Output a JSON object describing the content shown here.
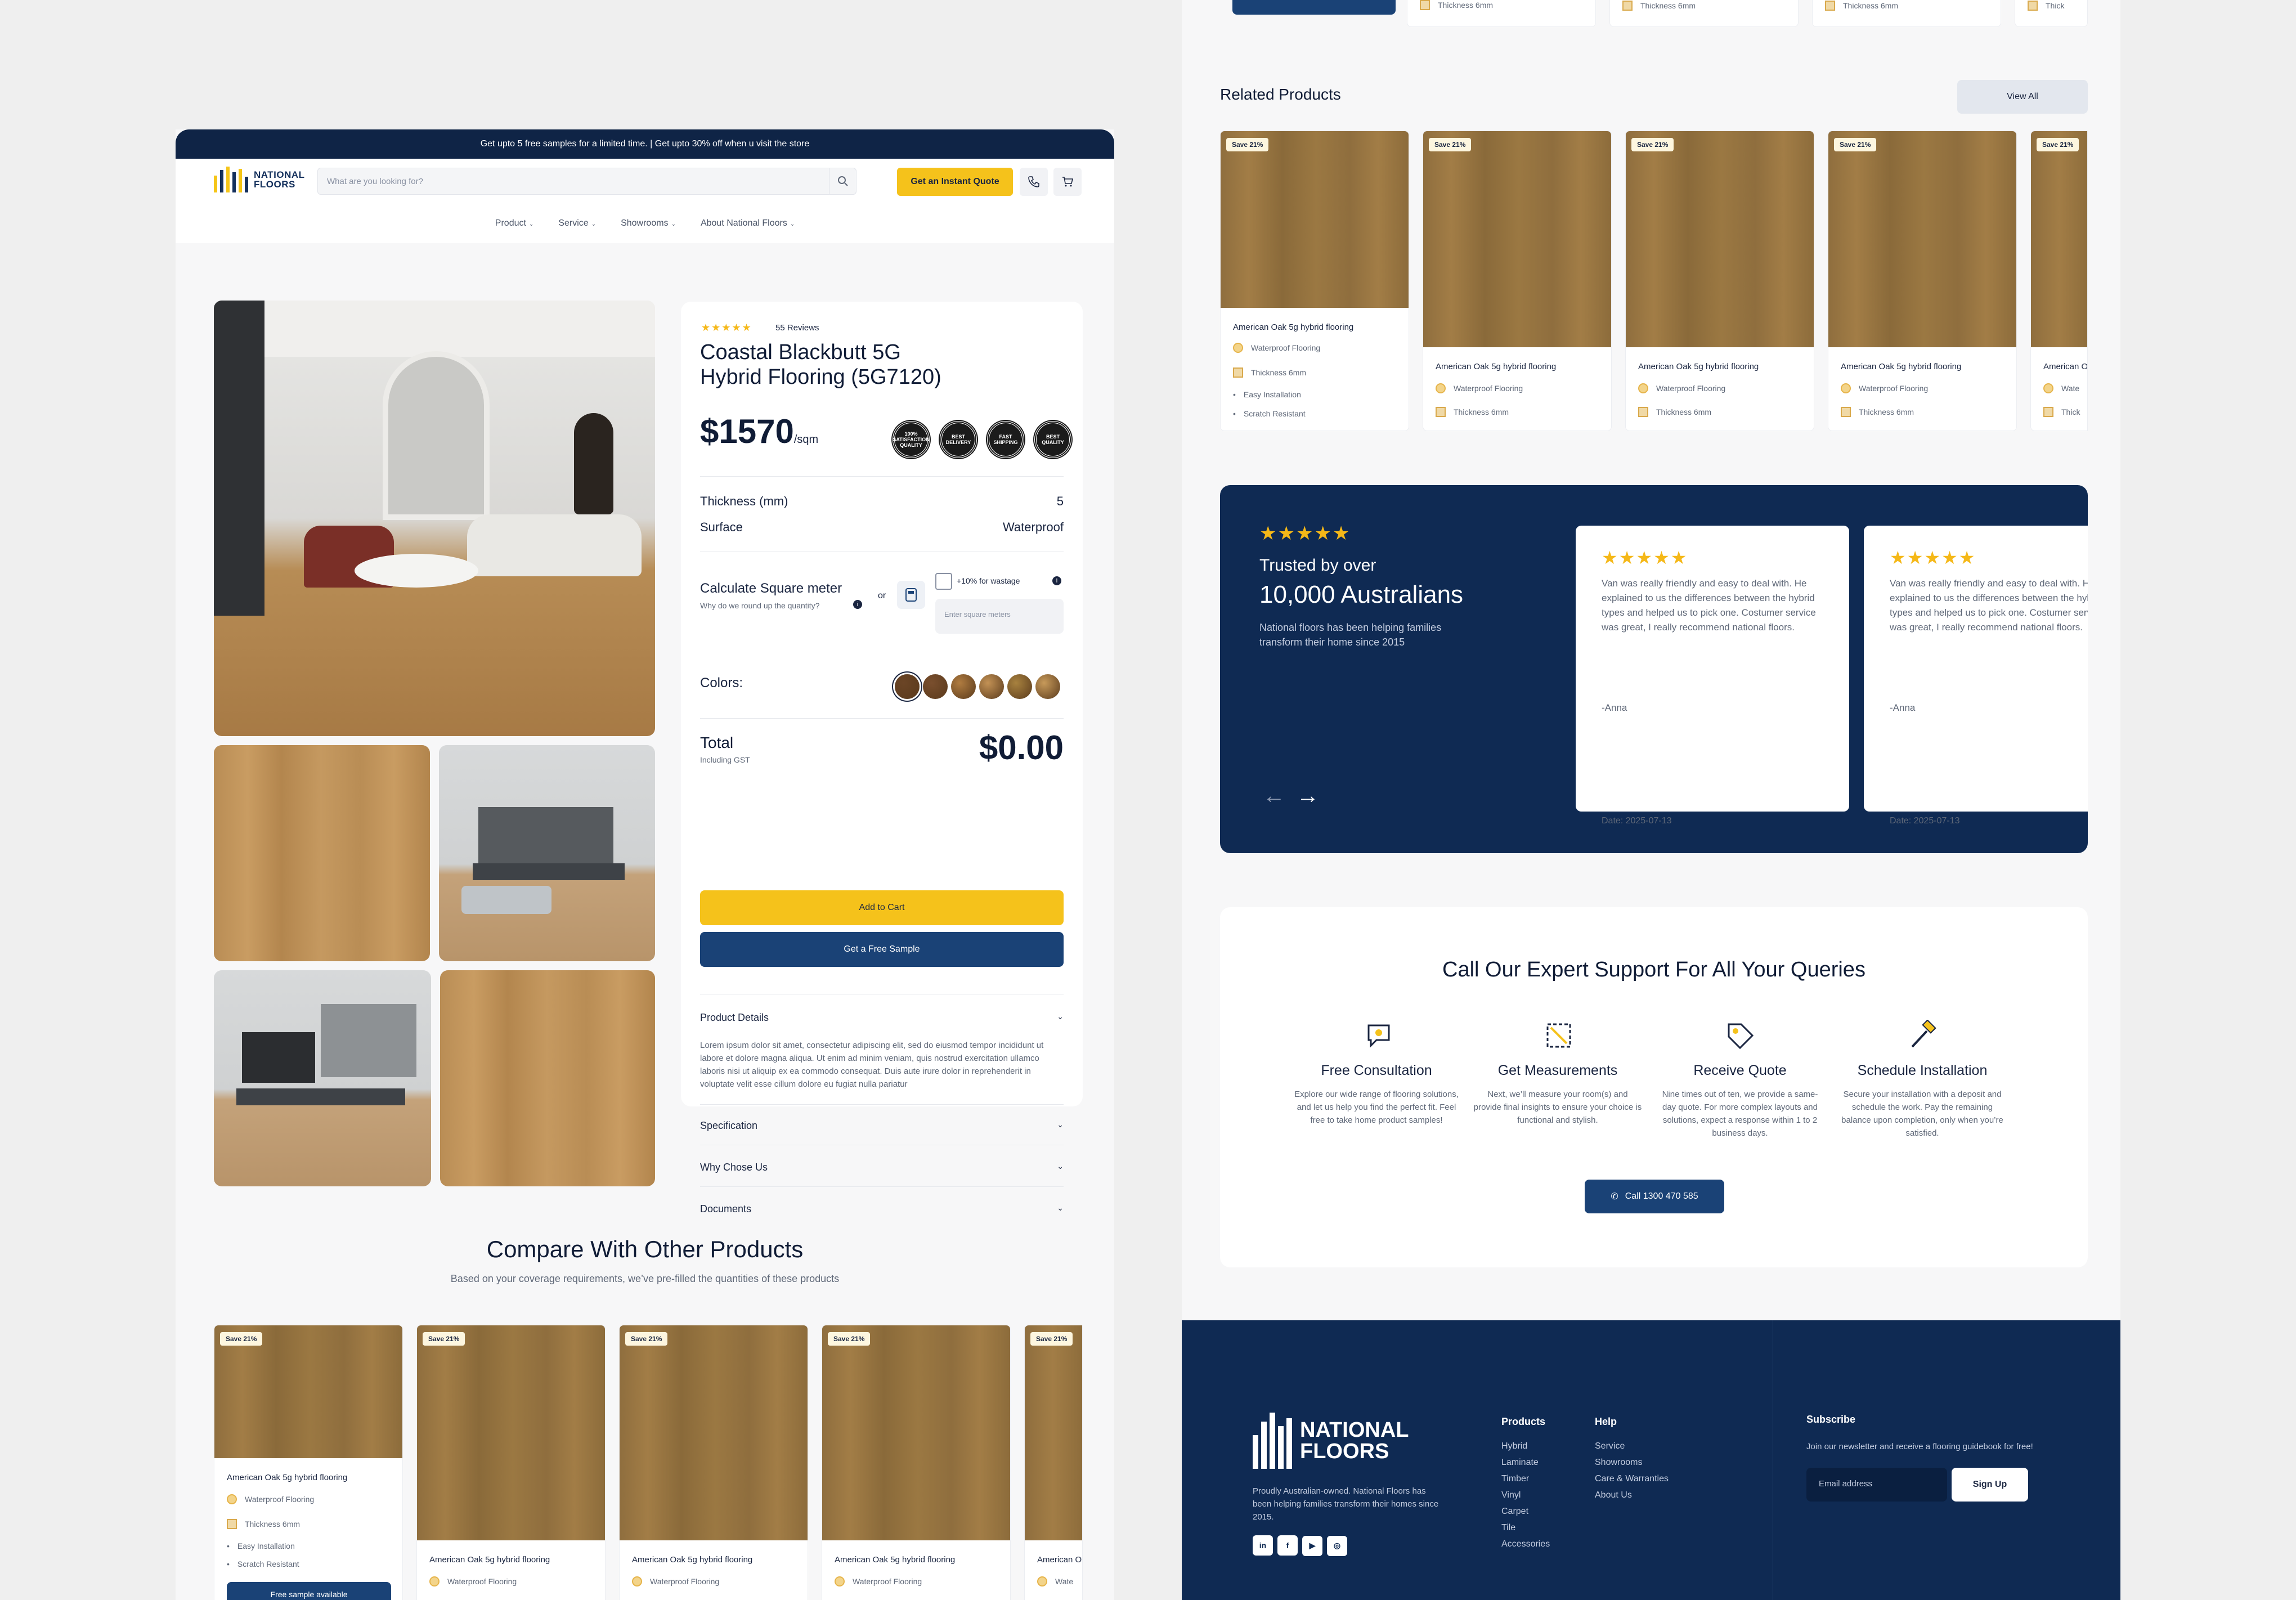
{
  "announcement": "Get upto 5 free samples for a limited time. | Get upto 30% off when u visit the store",
  "brand": {
    "line1": "NATIONAL",
    "line2": "FLOORS"
  },
  "search": {
    "placeholder": "What are you looking for?"
  },
  "header": {
    "quote_button": "Get an Instant Quote"
  },
  "nav": [
    "Product",
    "Service",
    "Showrooms",
    "About National Floors"
  ],
  "product": {
    "reviews": "55 Reviews",
    "title_line1": "Coastal Blackbutt 5G",
    "title_line2": "Hybrid Flooring (5G7120)",
    "price": "$1570",
    "price_unit": "/sqm",
    "badges": [
      "100% SATISFACTION QUALITY",
      "BEST DELIVERY",
      "FAST SHIPPING",
      "BEST QUALITY"
    ],
    "thickness_label": "Thickness (mm)",
    "thickness_value": "5",
    "surface_label": "Surface",
    "surface_value": "Waterproof",
    "calc_label": "Calculate Square meter",
    "calc_hint": "Why do we round up the quantity?",
    "or": "or",
    "wastage_label": "+10% for wastage",
    "sqm_placeholder": "Enter square meters",
    "colors_label": "Colors:",
    "swatches": [
      "#6b4526",
      "#7a4f2e",
      "#b07c40",
      "#c39255",
      "#a8823f",
      "#c79a5a"
    ],
    "total_label": "Total",
    "total_sub": "Including GST",
    "total_value": "$0.00",
    "add_to_cart": "Add to Cart",
    "free_sample": "Get a Free Sample",
    "details_title": "Product Details",
    "details_text": "Lorem ipsum dolor sit amet, consectetur adipiscing elit, sed do eiusmod tempor incididunt ut labore et dolore magna aliqua. Ut enim ad minim veniam, quis nostrud exercitation ullamco laboris nisi ut aliquip ex ea commodo consequat. Duis aute irure dolor in reprehenderit in voluptate velit esse cillum dolore eu fugiat nulla pariatur",
    "accordions": [
      "Specification",
      "Why Chose Us",
      "Documents"
    ]
  },
  "compare": {
    "title": "Compare With Other Products",
    "subtitle": "Based on your coverage requirements, we’ve pre-filled the quantities of these products"
  },
  "card": {
    "save": "Save 21%",
    "name": "American Oak 5g hybrid flooring",
    "name_cut": "American O",
    "waterproof": "Waterproof Flooring",
    "waterproof_cut": "Wate",
    "thickness": "Thickness 6mm",
    "thickness_cut": "Thick",
    "easy": "Easy Installation",
    "scratch": "Scratch Resistant",
    "sample_btn": "Free sample available"
  },
  "related": {
    "title": "Related Products",
    "view_all": "View All"
  },
  "reviews": {
    "stars": "★★★★★",
    "trusted": "Trusted by over",
    "count": "10,000 Australians",
    "blurb": "National floors has been helping families transform their home  since 2015",
    "text": "Van was really friendly and easy to deal with. He explained to us the differences between the hybrid types and helped us to pick one. Costumer service was great, I really recommend national floors.",
    "author": "-Anna",
    "date": "Date: 2025-07-13"
  },
  "support": {
    "title": "Call Our Expert Support For All Your Queries",
    "steps": [
      {
        "title": "Free Consultation",
        "text": "Explore our wide range of flooring solutions, and let us help you find the perfect fit. Feel free to take home product samples!"
      },
      {
        "title": "Get Measurements",
        "text": "Next, we’ll measure your room(s) and provide final insights to ensure your choice is functional and stylish."
      },
      {
        "title": "Receive Quote",
        "text": "Nine times out of ten, we provide a same-day quote. For more complex layouts and solutions, expect a response within 1 to 2 business days."
      },
      {
        "title": "Schedule Installation",
        "text": "Secure your installation with a deposit and schedule the work. Pay the remaining balance upon completion, only when you’re satisfied."
      }
    ],
    "call": "Call 1300 470 585"
  },
  "footer": {
    "tagline": "Proudly Australian-owned. National Floors has been helping families transform their homes since 2015.",
    "products_head": "Products",
    "products": [
      "Hybrid",
      "Laminate",
      "Timber",
      "Vinyl",
      "Carpet",
      "Tile",
      "Accessories"
    ],
    "help_head": "Help",
    "help": [
      "Service",
      "Showrooms",
      "Care & Warranties",
      "About Us"
    ],
    "subscribe_head": "Subscribe",
    "subscribe_text": "Join our newsletter and receive a flooring guidebook for free!",
    "email_placeholder": "Email address",
    "signup": "Sign Up",
    "social": [
      "in",
      "f",
      "▶",
      "◎"
    ]
  }
}
